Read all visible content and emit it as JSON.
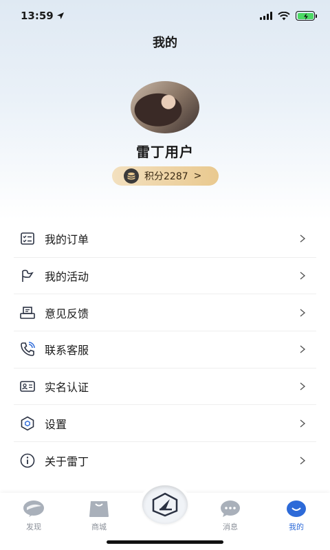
{
  "status_bar": {
    "time": "13:59"
  },
  "header": {
    "title": "我的"
  },
  "profile": {
    "user_name": "雷丁用户",
    "points_label": "积分2287",
    "points_chevron": ">"
  },
  "menu": {
    "items": [
      {
        "label": "我的订单",
        "icon": "order-list-icon"
      },
      {
        "label": "我的活动",
        "icon": "flag-icon"
      },
      {
        "label": "意见反馈",
        "icon": "feedback-icon"
      },
      {
        "label": "联系客服",
        "icon": "phone-icon"
      },
      {
        "label": "实名认证",
        "icon": "id-card-icon"
      },
      {
        "label": "设置",
        "icon": "settings-hexagon-icon"
      },
      {
        "label": "关于雷丁",
        "icon": "info-icon"
      }
    ]
  },
  "tab_bar": {
    "tabs": [
      {
        "label": "发现",
        "icon": "discover-icon"
      },
      {
        "label": "商城",
        "icon": "shopping-bag-icon"
      },
      {
        "label": "消息",
        "icon": "chat-bubble-icon"
      },
      {
        "label": "我的",
        "icon": "profile-face-icon"
      }
    ],
    "active": "我的"
  },
  "colors": {
    "accent": "#2d6ad8",
    "points_gold": "#e9c98f",
    "inactive_tab": "#8a8f98"
  }
}
